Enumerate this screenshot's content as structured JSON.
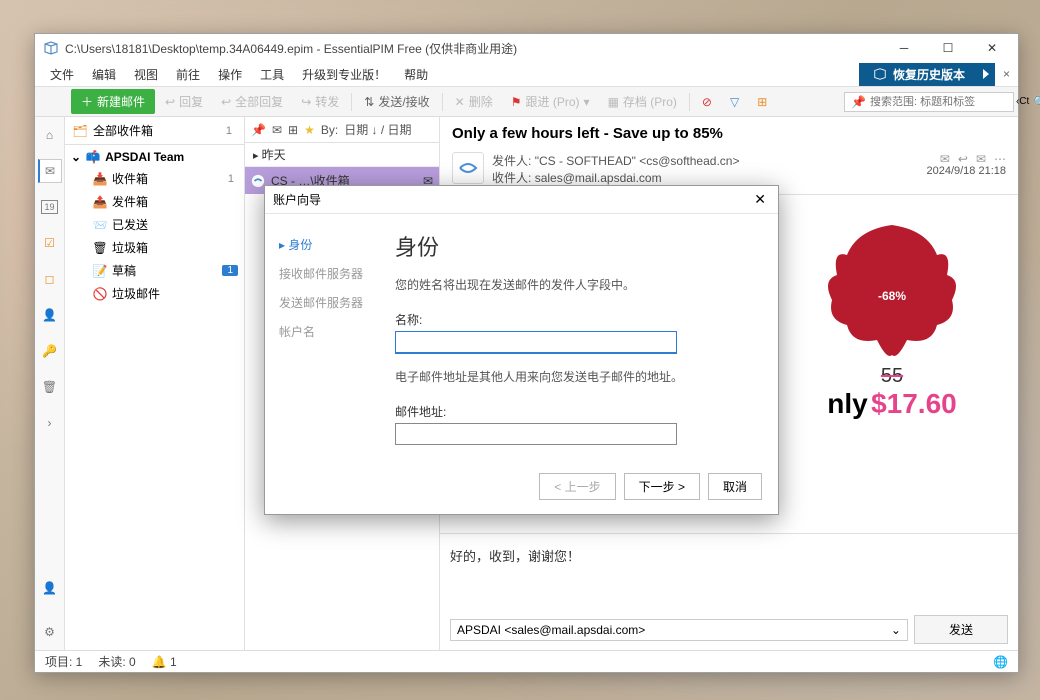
{
  "titlebar": {
    "path": "C:\\Users\\18181\\Desktop\\temp.34A06449.epim - EssentialPIM Free (仅供非商业用途)"
  },
  "menu": [
    "文件",
    "编辑",
    "视图",
    "前往",
    "操作",
    "工具",
    "升级到专业版！",
    "帮助"
  ],
  "restore": "恢复历史版本",
  "toolbar": {
    "new": "新建邮件",
    "reply": "回复",
    "reply_all": "全部回复",
    "forward": "转发",
    "send_recv": "发送/接收",
    "delete": "删除",
    "followup": "跟进 (Pro)",
    "archive": "存档 (Pro)",
    "search_placeholder": "搜索范围: 标题和标签"
  },
  "all_inbox": {
    "label": "全部收件箱",
    "count": "1"
  },
  "account": "APSDAI Team",
  "folders": [
    {
      "label": "收件箱",
      "count": "1",
      "icon": "inbox"
    },
    {
      "label": "发件箱",
      "icon": "outbox"
    },
    {
      "label": "已发送",
      "icon": "sent"
    },
    {
      "label": "垃圾箱",
      "icon": "trash"
    },
    {
      "label": "草稿",
      "badge": "1",
      "icon": "draft"
    },
    {
      "label": "垃圾邮件",
      "icon": "junk"
    }
  ],
  "msglist": {
    "by": "By:",
    "sort": "日期 ↓ / 日期",
    "section": "昨天",
    "from": "CS - …\\收件箱"
  },
  "preview": {
    "subject": "Only a few hours left - Save up to 85%",
    "from_label": "发件人:",
    "from": "\"CS - SOFTHEAD\" <cs@softhead.cn>",
    "to_label": "收件人:",
    "to": "sales@mail.apsdai.com",
    "date": "2024/9/18 21:18",
    "discount": "-68%",
    "old_price": "55",
    "only": "nly",
    "price": "$17.60"
  },
  "reply": {
    "text": "好的，收到，谢谢您！",
    "from": "APSDAI <sales@mail.apsdai.com>",
    "send": "发送"
  },
  "status": {
    "items": "项目: 1",
    "unread": "未读: 0",
    "notif": "1"
  },
  "wizard": {
    "title": "账户向导",
    "nav": [
      "身份",
      "接收邮件服务器",
      "发送邮件服务器",
      "帐户名"
    ],
    "heading": "身份",
    "desc1": "您的姓名将出现在发送邮件的发件人字段中。",
    "name_label": "名称:",
    "desc2": "电子邮件地址是其他人用来向您发送电子邮件的地址。",
    "email_label": "邮件地址:",
    "prev": "< 上一步",
    "next": "下一步 >",
    "cancel": "取消"
  }
}
